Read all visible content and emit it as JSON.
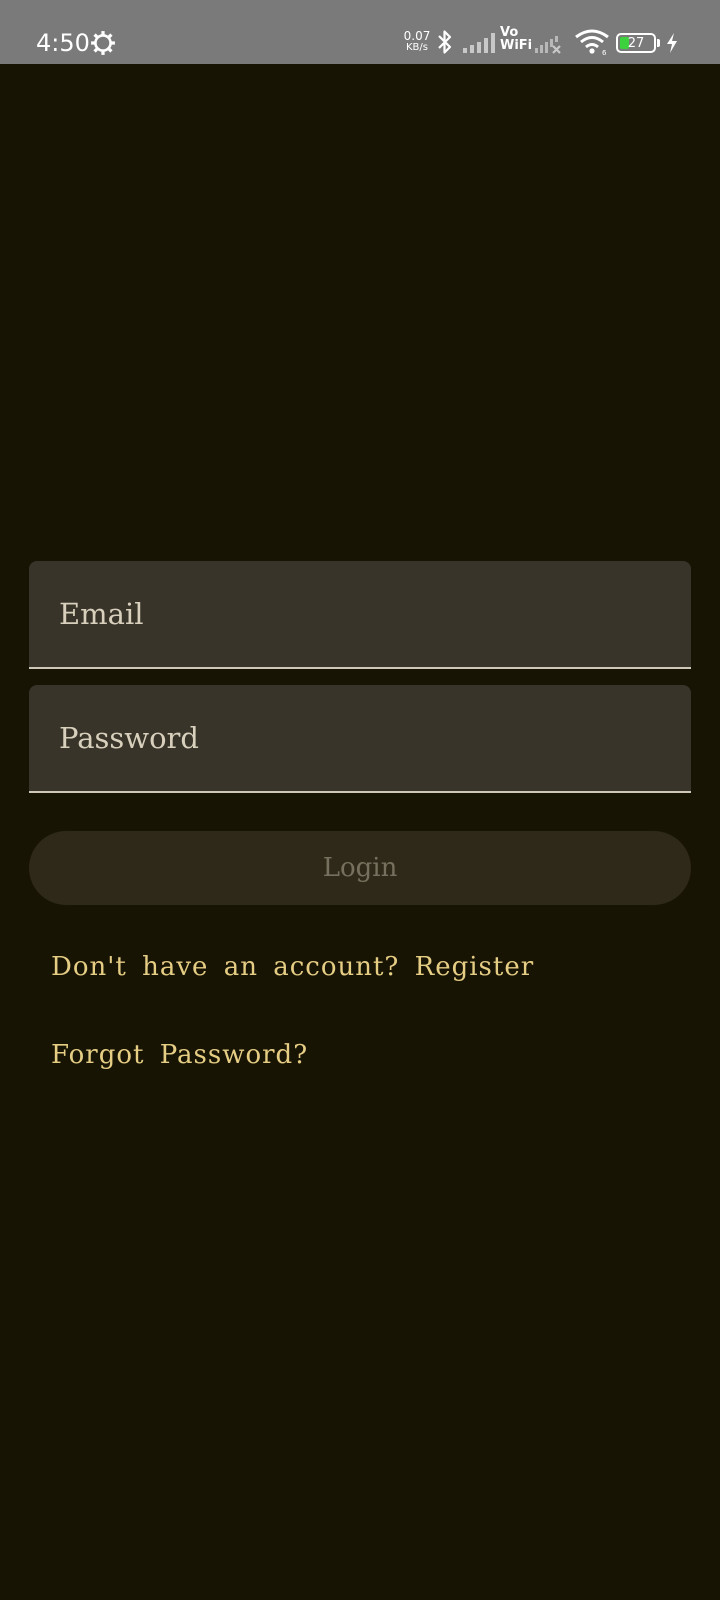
{
  "status_bar": {
    "time": "4:50",
    "net_speed_value": "0.07",
    "net_speed_unit": "KB/s",
    "vowifi_top": "Vo",
    "vowifi_bottom": "WiFi",
    "battery_level": "27",
    "battery_fraction": 0.27,
    "battery_color": "#3dd13d",
    "icons": [
      "settings-gear-icon",
      "bluetooth-icon",
      "cell-signal-icon",
      "vowifi-icon",
      "cell-signal-no-service-icon",
      "wifi-icon",
      "battery-icon",
      "charging-bolt-icon"
    ]
  },
  "login_form": {
    "email_placeholder": "Email",
    "password_placeholder": "Password",
    "login_label": "Login",
    "register_link": "Don't have an account? Register",
    "forgot_password_link": "Forgot Password?"
  },
  "colors": {
    "background": "#181403",
    "field_background": "#38342a",
    "accent_text": "#e5cd84",
    "button_background": "#2e2919",
    "button_text_disabled": "#77705e"
  }
}
